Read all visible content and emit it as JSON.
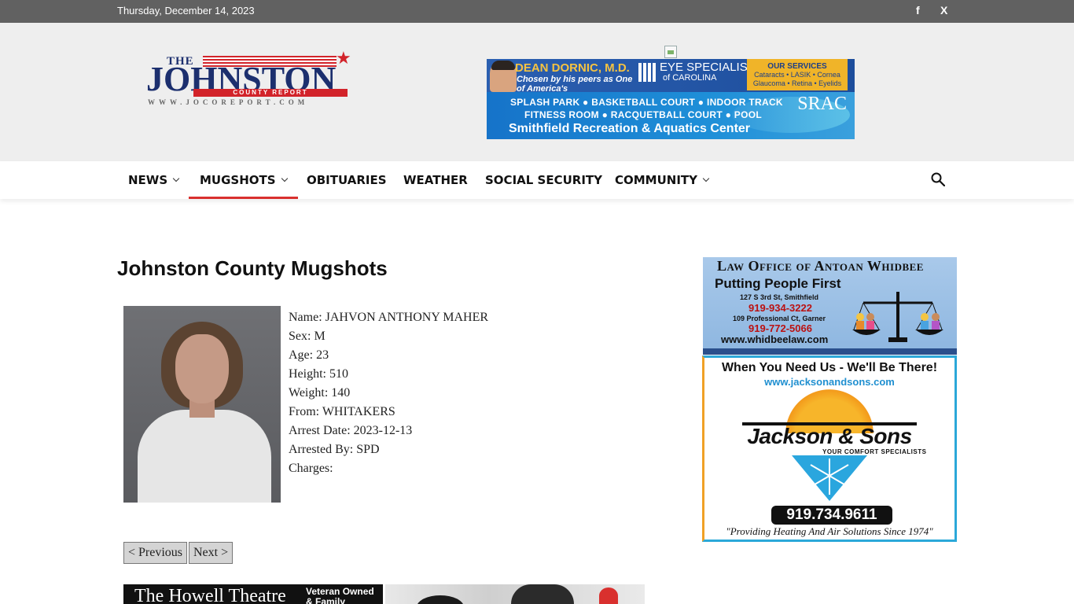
{
  "topbar": {
    "date": "Thursday, December 14, 2023",
    "social": [
      {
        "icon": "facebook-icon",
        "label": "f"
      },
      {
        "icon": "x-twitter-icon",
        "label": "X"
      }
    ]
  },
  "logo": {
    "the": "THE",
    "name": "JOHNSTON",
    "band": "COUNTY REPORT",
    "url": "WWW.JOCOREPORT.COM"
  },
  "header_ad": {
    "doctor": "DEAN DORNIC, M.D.",
    "chosen": "Chosen by his peers as One of America's",
    "eye_line1": "EYE SPECIALISTS",
    "eye_line2": "of CAROLINA",
    "services_title": "OUR SERVICES",
    "services_1": "Cataracts • LASIK • Cornea",
    "services_2": "Glaucoma • Retina • Eyelids",
    "line1": "SPLASH PARK ● BASKETBALL COURT ● INDOOR TRACK",
    "line2": "FITNESS ROOM ● RACQUETBALL COURT ● POOL",
    "line3": "Smithfield Recreation & Aquatics Center",
    "srac": "SRAC"
  },
  "nav": {
    "items": [
      {
        "label": "NEWS",
        "dropdown": true
      },
      {
        "label": "MUGSHOTS",
        "dropdown": true,
        "active": true
      },
      {
        "label": "OBITUARIES",
        "dropdown": false
      },
      {
        "label": "WEATHER",
        "dropdown": false
      },
      {
        "label": "SOCIAL SECURITY",
        "dropdown": false
      },
      {
        "label": "COMMUNITY",
        "dropdown": true
      }
    ],
    "search_icon": "search-icon"
  },
  "main": {
    "title": "Johnston County Mugshots",
    "record": {
      "name": "Name: JAHVON ANTHONY MAHER",
      "sex": "Sex: M",
      "age": "Age: 23",
      "height": "Height: 510",
      "weight": "Weight: 140",
      "from": "From: WHITAKERS",
      "arrest_date": "Arrest Date: 2023-12-13",
      "arrested_by": "Arrested By: SPD",
      "charges": "Charges:"
    },
    "pager": {
      "previous": "< Previous",
      "next": "Next >"
    },
    "bottom_ads": {
      "howell": "The Howell Theatre",
      "howell_tag": "Veteran Owned & Family Operated"
    }
  },
  "sidebar": {
    "law_ad": {
      "heading": "Law Office of Antoan Whidbee",
      "tagline": "Putting People First",
      "address1": "127 S 3rd St, Smithfield",
      "phone1": "919-934-3222",
      "address2": "109 Professional Ct, Garner",
      "phone2": "919-772-5066",
      "website": "www.whidbeelaw.com"
    },
    "jackson_ad": {
      "headline": "When You Need Us - We'll Be There!",
      "website": "www.jacksonandsons.com",
      "name": "Jackson & Sons",
      "tag": "YOUR COMFORT SPECIALISTS",
      "phone": "919.734.9611",
      "quote": "\"Providing Heating And Air Solutions Since 1974\""
    }
  }
}
